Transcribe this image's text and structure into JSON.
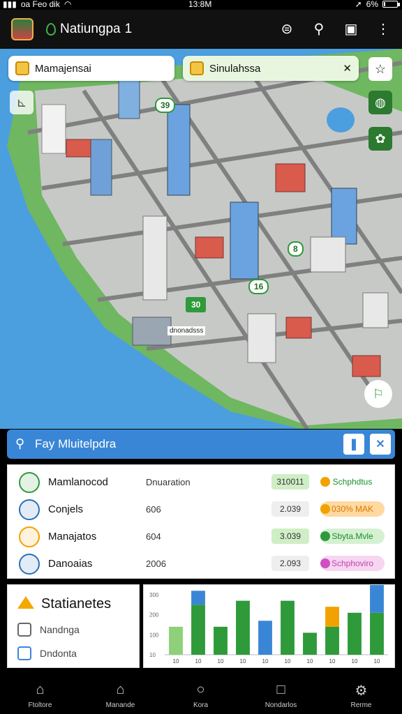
{
  "status_bar": {
    "carrier": "oa Feo dik",
    "time": "13:8M",
    "battery": "6%",
    "battery_level": 0.1
  },
  "app_bar": {
    "title": "Natiungpa",
    "title_suffix": "1"
  },
  "map": {
    "chip_left": "Mamajensai",
    "chip_right": "Sinulahssa",
    "markers": [
      "39",
      "8",
      "16",
      "30"
    ],
    "marker_caption": "dnonadsss"
  },
  "search": {
    "prefix": "Fay",
    "query": "Mluitelpdra"
  },
  "list": [
    {
      "name": "Mamlanocod",
      "type": "Dnuaration",
      "value": "310011",
      "value_color": "#cfeec6",
      "tag": "Schphdtus",
      "tag_color": "#ffffff",
      "tag_text_color": "#1a8f2c",
      "dot_color": "#f2a200",
      "icon_color": "#2e9a3a"
    },
    {
      "name": "Conjels",
      "type": "606",
      "value": "2.039",
      "value_color": "#eeeeee",
      "tag": "030% MAK",
      "tag_color": "#ffd9a0",
      "tag_text_color": "#d67a00",
      "dot_color": "#f2a200",
      "icon_color": "#2b6fb8"
    },
    {
      "name": "Manajatos",
      "type": "604",
      "value": "3.039",
      "value_color": "#cfeec6",
      "tag": "Sbyta.Mvle",
      "tag_color": "#d6f0d2",
      "tag_text_color": "#1a8f2c",
      "dot_color": "#2e9a3a",
      "icon_color": "#f2a200"
    },
    {
      "name": "Danoaias",
      "type": "2006",
      "value": "2.093",
      "value_color": "#eeeeee",
      "tag": "Schphoviro",
      "tag_color": "#f6d6f0",
      "tag_text_color": "#c040b0",
      "dot_color": "#d050c0",
      "icon_color": "#2b6fb8"
    }
  ],
  "stats": {
    "title": "Statianetes",
    "items": [
      "Nandnga",
      "Dndonta"
    ]
  },
  "chart_data": {
    "type": "bar",
    "categories": [
      "10",
      "10",
      "10",
      "10",
      "10",
      "10",
      "10",
      "10",
      "10",
      "10"
    ],
    "ylim": [
      0,
      300
    ],
    "ytick_labels": [
      "300",
      "200",
      "100",
      "10"
    ],
    "series": [
      {
        "values": [
          140,
          0,
          0,
          0,
          0,
          0,
          0,
          0,
          0,
          0
        ],
        "color": "#8fd07a"
      },
      {
        "values": [
          0,
          250,
          140,
          270,
          0,
          270,
          110,
          140,
          210,
          210
        ],
        "color": "#2e9a3a"
      },
      {
        "values": [
          0,
          70,
          0,
          0,
          170,
          0,
          0,
          0,
          0,
          260
        ],
        "color": "#3a86d6"
      },
      {
        "values": [
          0,
          0,
          0,
          0,
          0,
          0,
          0,
          100,
          0,
          0
        ],
        "color": "#f2a200"
      }
    ]
  },
  "bottom_nav": [
    {
      "label": "Ftoltore",
      "icon": "home-icon"
    },
    {
      "label": "Manande",
      "icon": "home-alt-icon"
    },
    {
      "label": "Kora",
      "icon": "circle-icon"
    },
    {
      "label": "Nondarlos",
      "icon": "square-icon"
    },
    {
      "label": "Rerme",
      "icon": "gear-icon"
    }
  ]
}
